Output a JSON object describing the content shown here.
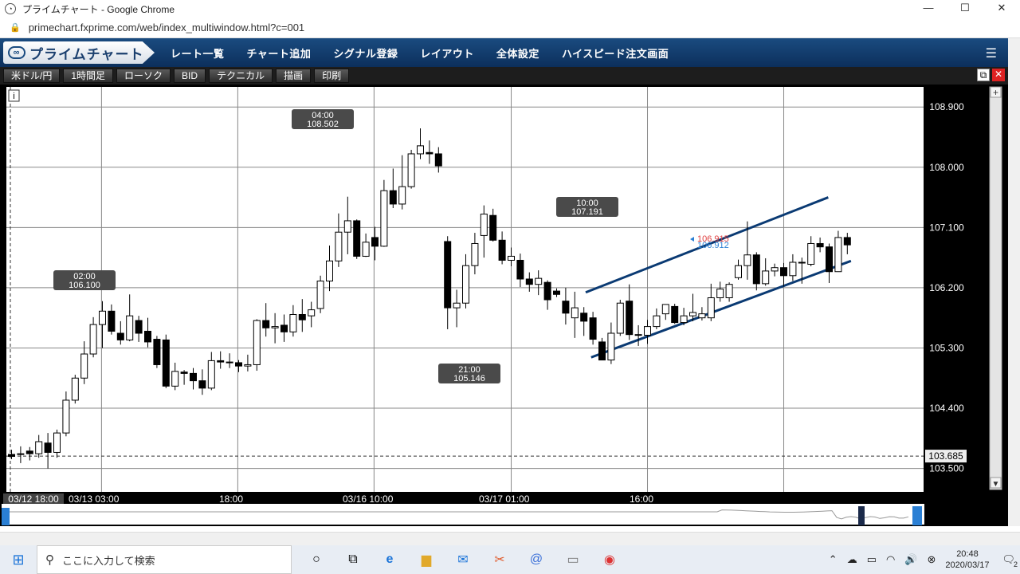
{
  "window": {
    "title": "プライムチャート - Google Chrome",
    "min": "—",
    "max": "☐",
    "close": "✕"
  },
  "browser": {
    "url": "primechart.fxprime.com/web/index_multiwindow.html?c=001"
  },
  "app": {
    "logo": "プライムチャート",
    "menu": [
      "レート一覧",
      "チャート追加",
      "シグナル登録",
      "レイアウト",
      "全体設定",
      "ハイスピード注文画面"
    ]
  },
  "toolbar": {
    "buttons": [
      "米ドル/円",
      "1時間足",
      "ローソク",
      "BID",
      "テクニカル",
      "描画",
      "印刷"
    ]
  },
  "chart_data": {
    "type": "candlestick",
    "symbol": "米ドル/円",
    "timeframe": "1時間足",
    "y_ticks": [
      108.9,
      108.0,
      107.1,
      106.2,
      105.3,
      104.4,
      103.5
    ],
    "y_tick_labels": [
      "108.900",
      "108.000",
      "107.100",
      "106.200",
      "105.300",
      "104.400",
      "103.500"
    ],
    "ylim": [
      103.15,
      109.2
    ],
    "x_tick_labels": [
      "03/12 18:00",
      "03/13 03:00",
      "18:00",
      "03/16 10:00",
      "03/17 01:00",
      "16:00"
    ],
    "reference_line": {
      "value": 103.685,
      "label": "103.685"
    },
    "current_ask": "106.915",
    "current_bid": "106.912",
    "annotations": [
      {
        "time": "02:00",
        "price": "106.100"
      },
      {
        "time": "04:00",
        "price": "108.502"
      },
      {
        "time": "21:00",
        "price": "105.146"
      },
      {
        "time": "10:00",
        "price": "107.191"
      }
    ],
    "candles": [
      [
        103.71,
        103.68,
        103.64,
        103.78
      ],
      [
        103.71,
        103.72,
        103.58,
        103.83
      ],
      [
        103.76,
        103.72,
        103.62,
        103.82
      ],
      [
        103.72,
        103.9,
        103.66,
        104.0
      ],
      [
        103.88,
        103.74,
        103.5,
        104.03
      ],
      [
        103.74,
        104.03,
        103.66,
        104.08
      ],
      [
        104.03,
        104.52,
        103.98,
        104.65
      ],
      [
        104.52,
        104.85,
        104.47,
        104.9
      ],
      [
        104.85,
        105.21,
        104.76,
        105.4
      ],
      [
        105.21,
        105.65,
        105.16,
        105.76
      ],
      [
        105.65,
        105.85,
        105.3,
        106.0
      ],
      [
        105.85,
        105.55,
        105.5,
        105.95
      ],
      [
        105.52,
        105.42,
        105.35,
        105.7
      ],
      [
        105.42,
        105.78,
        105.4,
        106.1
      ],
      [
        105.71,
        105.52,
        105.39,
        105.78
      ],
      [
        105.55,
        105.39,
        105.31,
        105.75
      ],
      [
        105.43,
        105.05,
        105.0,
        105.48
      ],
      [
        105.42,
        104.73,
        104.7,
        105.5
      ],
      [
        104.73,
        104.95,
        104.67,
        105.08
      ],
      [
        104.94,
        104.92,
        104.75,
        104.97
      ],
      [
        104.92,
        104.81,
        104.68,
        105.0
      ],
      [
        104.81,
        104.7,
        104.6,
        104.98
      ],
      [
        104.7,
        105.11,
        104.67,
        105.24
      ],
      [
        105.11,
        105.09,
        104.99,
        105.25
      ],
      [
        105.09,
        105.08,
        105.0,
        105.22
      ],
      [
        105.08,
        105.03,
        104.94,
        105.12
      ],
      [
        105.03,
        105.05,
        104.95,
        105.2
      ],
      [
        105.05,
        105.71,
        104.96,
        105.73
      ],
      [
        105.71,
        105.6,
        105.47,
        105.97
      ],
      [
        105.6,
        105.62,
        105.37,
        105.82
      ],
      [
        105.64,
        105.54,
        105.39,
        105.8
      ],
      [
        105.54,
        105.8,
        105.47,
        105.94
      ],
      [
        105.8,
        105.72,
        105.54,
        106.03
      ],
      [
        105.78,
        105.87,
        105.61,
        105.99
      ],
      [
        105.89,
        106.3,
        105.82,
        106.38
      ],
      [
        106.3,
        106.6,
        106.15,
        106.83
      ],
      [
        106.6,
        107.03,
        106.51,
        107.31
      ],
      [
        107.03,
        107.2,
        106.7,
        107.56
      ],
      [
        107.2,
        106.67,
        106.63,
        107.22
      ],
      [
        106.67,
        106.88,
        106.66,
        107.01
      ],
      [
        106.95,
        106.82,
        106.61,
        107.11
      ],
      [
        106.82,
        107.65,
        106.81,
        107.81
      ],
      [
        107.65,
        107.45,
        107.39,
        107.98
      ],
      [
        107.45,
        107.71,
        107.37,
        108.18
      ],
      [
        107.71,
        108.2,
        107.68,
        108.26
      ],
      [
        108.2,
        108.32,
        108.12,
        108.58
      ],
      [
        108.22,
        108.2,
        108.05,
        108.4
      ],
      [
        108.2,
        108.02,
        107.92,
        108.3
      ],
      [
        106.89,
        105.9,
        105.58,
        106.97
      ],
      [
        105.9,
        105.97,
        105.61,
        106.17
      ],
      [
        105.97,
        106.53,
        105.89,
        106.7
      ],
      [
        106.53,
        106.86,
        106.4,
        107.02
      ],
      [
        106.98,
        107.3,
        106.65,
        107.43
      ],
      [
        107.28,
        106.91,
        106.89,
        107.38
      ],
      [
        106.91,
        106.61,
        106.55,
        107.04
      ],
      [
        106.61,
        106.67,
        106.52,
        106.8
      ],
      [
        106.61,
        106.33,
        106.21,
        106.71
      ],
      [
        106.33,
        106.25,
        106.14,
        106.43
      ],
      [
        106.25,
        106.34,
        106.09,
        106.46
      ],
      [
        106.28,
        106.02,
        105.87,
        106.31
      ],
      [
        106.15,
        106.1,
        106.06,
        106.19
      ],
      [
        106.0,
        105.82,
        105.65,
        106.2
      ],
      [
        105.75,
        105.9,
        105.45,
        106.14
      ],
      [
        105.82,
        105.7,
        105.48,
        105.91
      ],
      [
        105.75,
        105.43,
        105.35,
        105.84
      ],
      [
        105.39,
        105.12,
        105.146,
        105.45
      ],
      [
        105.12,
        105.52,
        105.06,
        105.68
      ],
      [
        105.52,
        105.97,
        105.48,
        106.02
      ],
      [
        106.0,
        105.5,
        105.42,
        106.25
      ],
      [
        105.5,
        105.49,
        105.33,
        105.64
      ],
      [
        105.49,
        105.62,
        105.36,
        105.72
      ],
      [
        105.62,
        105.78,
        105.58,
        105.89
      ],
      [
        105.81,
        105.95,
        105.72,
        105.9
      ],
      [
        105.92,
        105.68,
        105.66,
        105.96
      ],
      [
        105.68,
        105.78,
        105.64,
        105.9
      ],
      [
        105.78,
        105.83,
        105.7,
        106.11
      ],
      [
        105.75,
        105.81,
        105.71,
        105.91
      ],
      [
        105.75,
        106.05,
        105.7,
        106.26
      ],
      [
        106.05,
        106.18,
        105.99,
        106.29
      ],
      [
        106.05,
        106.25,
        105.99,
        106.28
      ],
      [
        106.35,
        106.53,
        106.32,
        106.62
      ],
      [
        106.53,
        106.69,
        106.32,
        107.191
      ],
      [
        106.69,
        106.26,
        106.16,
        106.73
      ],
      [
        106.26,
        106.45,
        106.23,
        106.64
      ],
      [
        106.45,
        106.5,
        106.37,
        106.56
      ],
      [
        106.5,
        106.38,
        106.22,
        106.57
      ],
      [
        106.38,
        106.58,
        106.3,
        106.7
      ],
      [
        106.58,
        106.57,
        106.26,
        106.65
      ],
      [
        106.55,
        106.86,
        106.52,
        106.97
      ],
      [
        106.86,
        106.81,
        106.73,
        106.95
      ],
      [
        106.81,
        106.44,
        106.27,
        106.86
      ],
      [
        106.44,
        106.95,
        106.44,
        107.05
      ],
      [
        106.95,
        106.84,
        106.7,
        107.02
      ]
    ],
    "channel_lines": [
      {
        "from": {
          "index": 63.2,
          "price": 106.13
        },
        "to": {
          "index": 89.9,
          "price": 107.55
        }
      },
      {
        "from": {
          "index": 63.8,
          "price": 105.16
        },
        "to": {
          "index": 92.4,
          "price": 106.6
        }
      }
    ]
  },
  "taskbar": {
    "search_placeholder": "ここに入力して検索",
    "time": "20:48",
    "date": "2020/03/17",
    "notification_count": "2"
  },
  "colors": {
    "chart_bg": "#000000",
    "plot_bg": "#ffffff",
    "nav_bg": "#0c2f5c",
    "channel_line": "#0a3a73",
    "ask_color": "#e04040",
    "bid_color": "#2a7fd4"
  }
}
